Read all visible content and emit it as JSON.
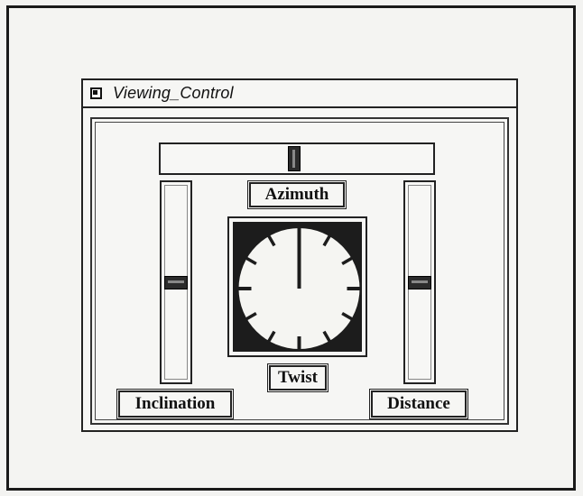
{
  "window": {
    "title": "Viewing_Control"
  },
  "controls": {
    "azimuth": {
      "label": "Azimuth",
      "level": 0.49
    },
    "inclination": {
      "label": "Inclination",
      "level": 0.5
    },
    "distance": {
      "label": "Distance",
      "level": 0.5
    },
    "twist": {
      "label": "Twist",
      "angle_deg": 0
    }
  },
  "colors": {
    "dial_background": "#1c1c1c",
    "dial_face": "#f5f5f2",
    "ink": "#111111"
  }
}
